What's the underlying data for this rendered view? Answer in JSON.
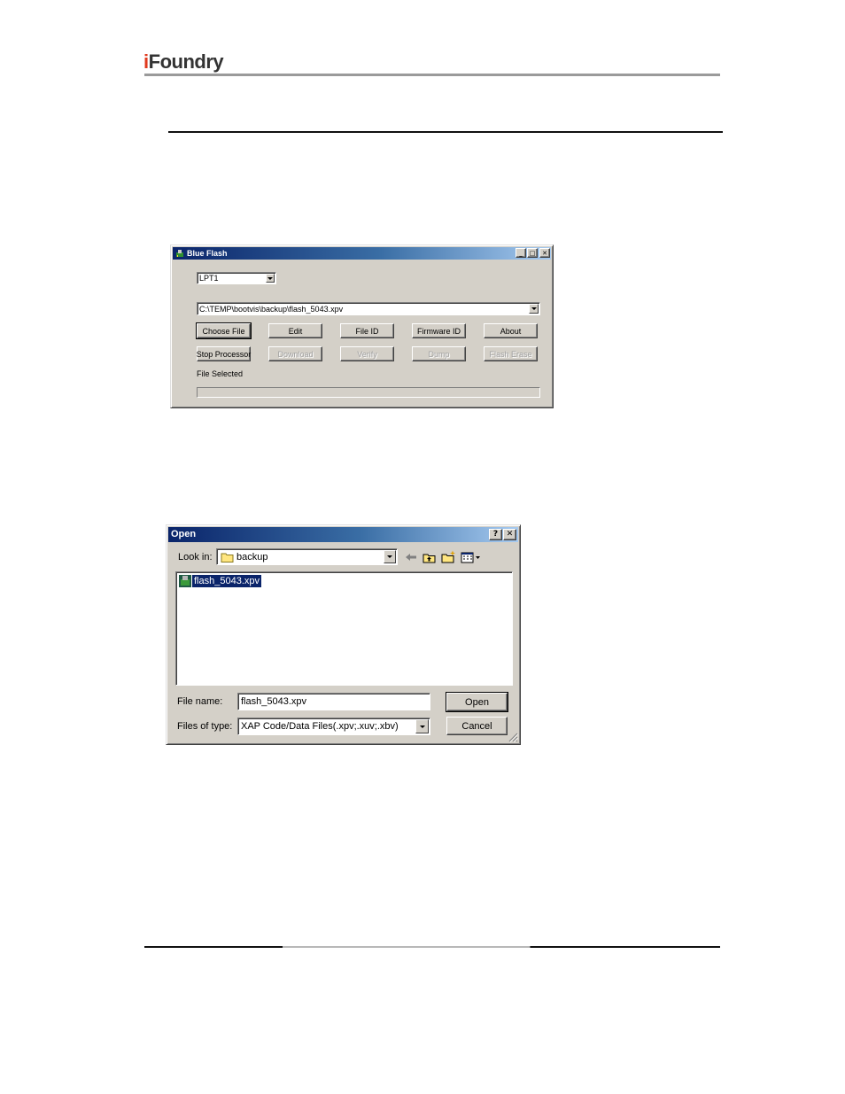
{
  "header": {
    "logo_i": "i",
    "logo_rest": "Foundry"
  },
  "blue_flash": {
    "title": "Blue Flash",
    "port_value": "LPT1",
    "file_path": "C:\\TEMP\\bootvis\\backup\\flash_5043.xpv",
    "buttons": {
      "choose_file": "Choose File",
      "edit": "Edit",
      "file_id": "File ID",
      "firmware_id": "Firmware ID",
      "about": "About",
      "stop_processor": "Stop Processor",
      "download": "Download",
      "verify": "Verify",
      "dump": "Dump",
      "flash_erase": "Flash Erase"
    },
    "status": "File Selected",
    "progress": 0
  },
  "open_dialog": {
    "title": "Open",
    "look_in_label": "Look in:",
    "look_in_value": "backup",
    "files": [
      {
        "name": "flash_5043.xpv",
        "selected": true
      }
    ],
    "file_name_label": "File name:",
    "file_name_value": "flash_5043.xpv",
    "file_type_label": "Files of type:",
    "file_type_value": "XAP Code/Data Files(.xpv;.xuv;.xbv)",
    "open_button": "Open",
    "cancel_button": "Cancel"
  }
}
